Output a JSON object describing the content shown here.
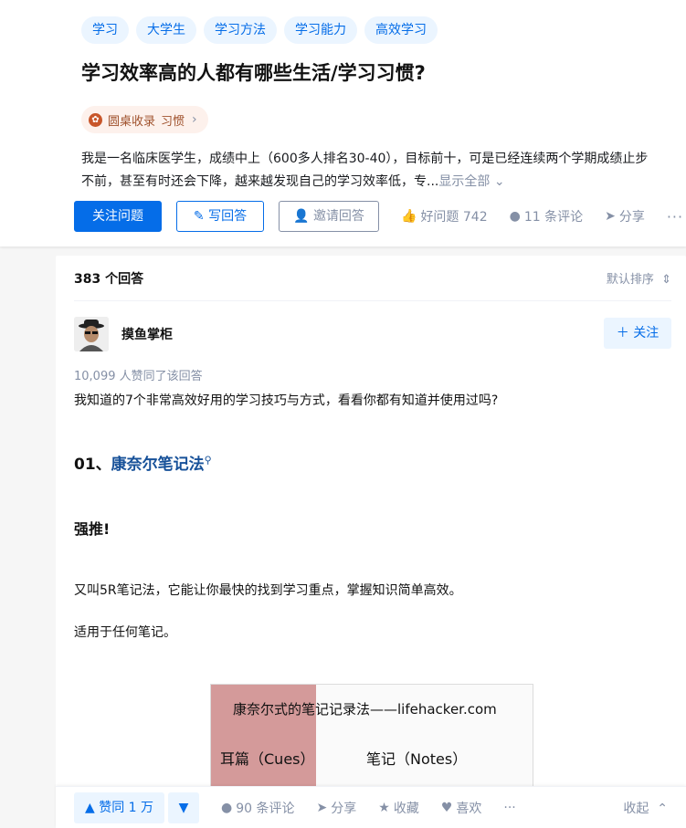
{
  "question": {
    "tags": [
      "学习",
      "大学生",
      "学习方法",
      "学习能力",
      "高效学习"
    ],
    "title": "学习效率高的人都有哪些生活/学习习惯?",
    "collection": {
      "label": "圆桌收录",
      "topic": "习惯"
    },
    "detail_line1": "我是一名临床医学生，成绩中上（600多人排名30-40），目标前十，可是已经连续两个学期成绩止步",
    "detail_line2": "不前，甚至有时还会下降，越来越发现自己的学习效率低，专...",
    "show_all": "显示全部",
    "actions": {
      "follow": "关注问题",
      "write": "写回答",
      "invite": "邀请回答",
      "good_question": "好问题 742",
      "comments": "11 条评论",
      "share": "分享"
    }
  },
  "answers": {
    "count_label": "383 个回答",
    "sort_label": "默认排序"
  },
  "answer": {
    "author": "摸鱼掌柜",
    "follow_label": "关注",
    "votes_text": "10,099 人赞同了该回答",
    "intro": "我知道的7个非常高效好用的学习技巧与方式，看看你都有知道并使用过吗?",
    "section_num": "01、",
    "section_link": "康奈尔笔记法",
    "emphasis": "强推!",
    "para1": "又叫5R笔记法，它能让你最快的找到学习重点，掌握知识简单高效。",
    "para2": "适用于任何笔记。",
    "figure": {
      "title": "康奈尔式的笔记记录法——lifehacker.com",
      "left_head": "耳篇（Cues）",
      "right_head": "笔记（Notes）"
    }
  },
  "bottom_bar": {
    "upvote": "赞同 1 万",
    "comments": "90 条评论",
    "share": "分享",
    "favorite": "收藏",
    "like": "喜欢",
    "collapse": "收起"
  },
  "colors": {
    "accent": "#056de8",
    "muted": "#8590a6",
    "link": "#175199"
  }
}
